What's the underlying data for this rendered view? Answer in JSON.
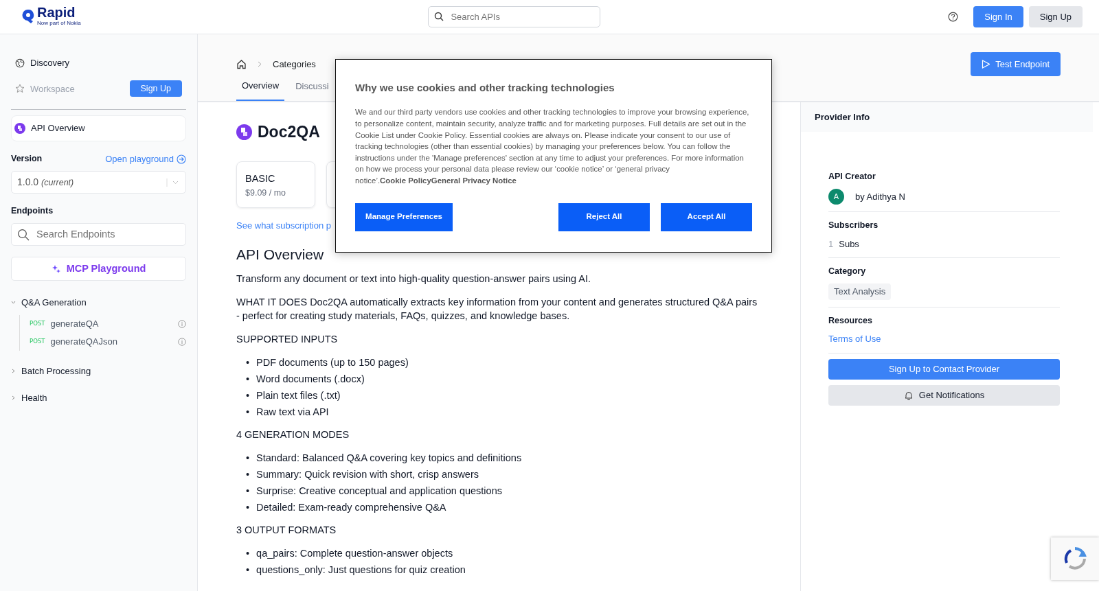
{
  "header": {
    "logo": {
      "name": "Rapid",
      "tagline": "Now part of Nokia"
    },
    "search": {
      "placeholder": "Search APIs"
    },
    "buttons": [
      {
        "label": "Sign In",
        "kind": "primary"
      },
      {
        "label": "Sign Up",
        "kind": "secondary"
      }
    ]
  },
  "sidebar": {
    "nav": [
      {
        "label": "Discovery",
        "disabled": false
      },
      {
        "label": "Workspace",
        "disabled": true
      }
    ],
    "workspace_button": "Sign Up",
    "api_overview": {
      "label": "API Overview",
      "selected": true
    },
    "version": {
      "label": "Version",
      "link": "Open playground",
      "value": "1.0.0",
      "note": "(current)"
    },
    "endpoints": {
      "label": "Endpoints",
      "placeholder": "Search Endpoints"
    },
    "mcp_button": "MCP Playground",
    "groups": [
      {
        "label": "Q&A Generation",
        "expanded": true,
        "children": [
          {
            "method": "POST",
            "name": "generateQA"
          },
          {
            "method": "POST",
            "name": "generateQAJson"
          }
        ]
      },
      {
        "label": "Batch Processing",
        "expanded": false
      },
      {
        "label": "Health",
        "expanded": false
      }
    ]
  },
  "main": {
    "breadcrumb": [
      "Categories"
    ],
    "tabs": [
      {
        "label": "Overview",
        "selected": true
      },
      {
        "label": "Discussi",
        "selected": false
      }
    ],
    "test_button": "Test Endpoint",
    "title": "Doc2QA",
    "plans": [
      {
        "kind": "plan",
        "name": "BASIC",
        "price": "$9.09 / mo"
      },
      {
        "kind": "covered"
      }
    ],
    "subscription_link": "See what subscription p",
    "section_title": "API Overview",
    "content": [
      {
        "kind": "p",
        "text": "Transform any document or text into high-quality question-answer pairs using AI."
      },
      {
        "kind": "p",
        "text": "WHAT IT DOES Doc2QA automatically extracts key information from your content and generates structured Q&A pairs - perfect for creating study materials, FAQs, quizzes, and knowledge bases."
      },
      {
        "kind": "p",
        "text": "SUPPORTED INPUTS"
      },
      {
        "kind": "ul",
        "marker": "•",
        "items": [
          "PDF documents (up to 150 pages)",
          "Word documents (.docx)",
          "Plain text files (.txt)",
          "Raw text via API"
        ]
      },
      {
        "kind": "p",
        "text": "4 GENERATION MODES"
      },
      {
        "kind": "ul",
        "marker": "•",
        "items": [
          "Standard: Balanced Q&A covering key topics and definitions",
          "Summary: Quick revision with short, crisp answers",
          "Surprise: Creative conceptual and application questions",
          "Detailed: Exam-ready comprehensive Q&A"
        ]
      },
      {
        "kind": "p",
        "text": "3 OUTPUT FORMATS"
      },
      {
        "kind": "ul",
        "marker": "•",
        "items": [
          "qa_pairs: Complete question-answer objects",
          "questions_only: Just questions for quiz creation"
        ]
      }
    ]
  },
  "provider": {
    "header": "Provider Info",
    "creator": {
      "label": "API Creator",
      "initial": "A",
      "by": "by",
      "name": "Adithya N"
    },
    "subscribers": {
      "label": "Subscribers",
      "count": "1",
      "unit": "Subs"
    },
    "category": {
      "label": "Category",
      "tag": "Text Analysis"
    },
    "resources": {
      "label": "Resources",
      "link": "Terms of Use"
    },
    "contact_button": "Sign Up to Contact Provider",
    "notify_button": "Get Notifications"
  },
  "cookie_dialog": {
    "title": "Why we use cookies and other tracking technologies",
    "body": "We and our third party vendors use cookies and other tracking technologies to improve your browsing experience, to personalize content, maintain security, analyze traffic and for marketing purposes. Full details are set out in the Cookie List under Cookie Policy. Essential cookies are always on. Please indicate your consent to our use of tracking technologies (other than essential cookies) by managing your preferences below. You can follow the instructions under the 'Manage preferences' section at any time to adjust your preferences. For more information on how we process your personal data please review our ‘cookie notice’ or ‘general privacy notice’.",
    "links": [
      "Cookie Policy",
      "General Privacy Notice"
    ],
    "buttons": [
      "Manage Preferences",
      "Reject All",
      "Accept All"
    ]
  }
}
